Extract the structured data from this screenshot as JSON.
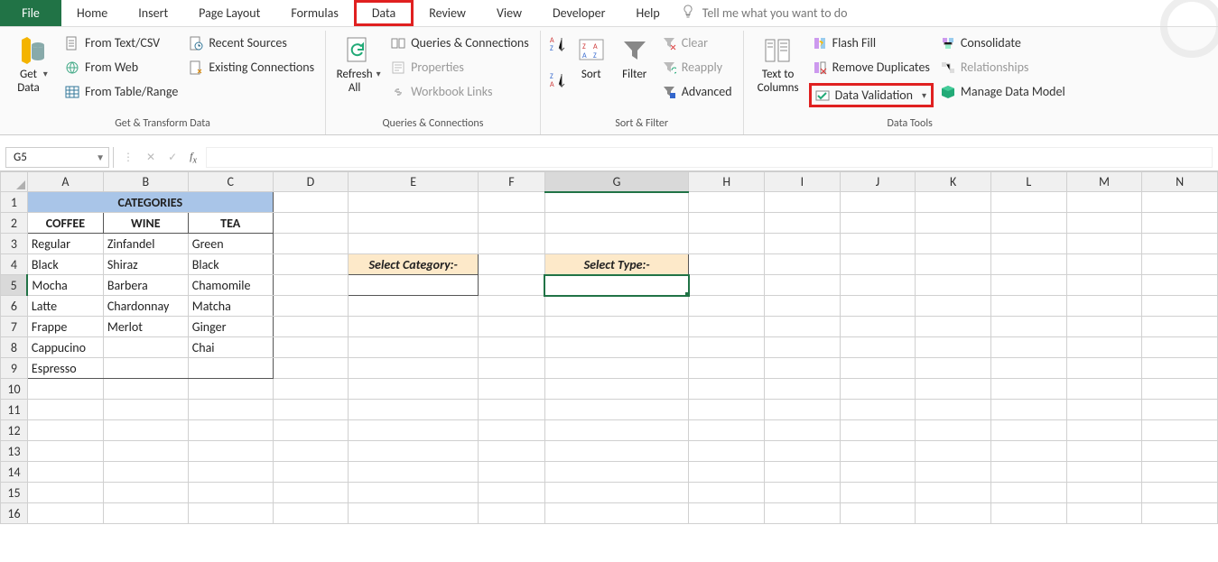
{
  "tabs": {
    "file": "File",
    "items": [
      "Home",
      "Insert",
      "Page Layout",
      "Formulas",
      "Data",
      "Review",
      "View",
      "Developer",
      "Help"
    ],
    "highlighted": "Data",
    "tell_me": "Tell me what you want to do"
  },
  "ribbon": {
    "get_transform": {
      "get_data": "Get\nData",
      "from_text_csv": "From Text/CSV",
      "from_web": "From Web",
      "from_table_range": "From Table/Range",
      "recent_sources": "Recent Sources",
      "existing_connections": "Existing Connections",
      "label": "Get & Transform Data"
    },
    "queries": {
      "refresh_all": "Refresh\nAll",
      "queries_connections": "Queries & Connections",
      "properties": "Properties",
      "workbook_links": "Workbook Links",
      "label": "Queries & Connections"
    },
    "sort_filter": {
      "sort": "Sort",
      "filter": "Filter",
      "clear": "Clear",
      "reapply": "Reapply",
      "advanced": "Advanced",
      "label": "Sort & Filter"
    },
    "data_tools": {
      "text_to_columns": "Text to\nColumns",
      "flash_fill": "Flash Fill",
      "remove_duplicates": "Remove Duplicates",
      "data_validation": "Data Validation",
      "consolidate": "Consolidate",
      "relationships": "Relationships",
      "manage_data_model": "Manage Data Model",
      "label": "Data Tools"
    }
  },
  "namebox": "G5",
  "sheet": {
    "columns": [
      "A",
      "B",
      "C",
      "D",
      "E",
      "F",
      "G",
      "H",
      "I",
      "J",
      "K",
      "L",
      "M",
      "N"
    ],
    "row_count": 16,
    "active_col": "G",
    "active_row": 5,
    "categories_header": "CATEGORIES",
    "sub_headers": {
      "A": "COFFEE",
      "B": "WINE",
      "C": "TEA"
    },
    "cells": {
      "A3": "Regular",
      "B3": "Zinfandel",
      "C3": "Green",
      "A4": "Black",
      "B4": "Shiraz",
      "C4": "Black",
      "A5": "Mocha",
      "B5": "Barbera",
      "C5": "Chamomile",
      "A6": "Latte",
      "B6": "Chardonnay",
      "C6": "Matcha",
      "A7": "Frappe",
      "B7": "Merlot",
      "C7": "Ginger",
      "A8": "Cappucino",
      "C8": "Chai",
      "A9": "Espresso",
      "E4": "Select Category:-",
      "G4": "Select Type:-"
    }
  }
}
